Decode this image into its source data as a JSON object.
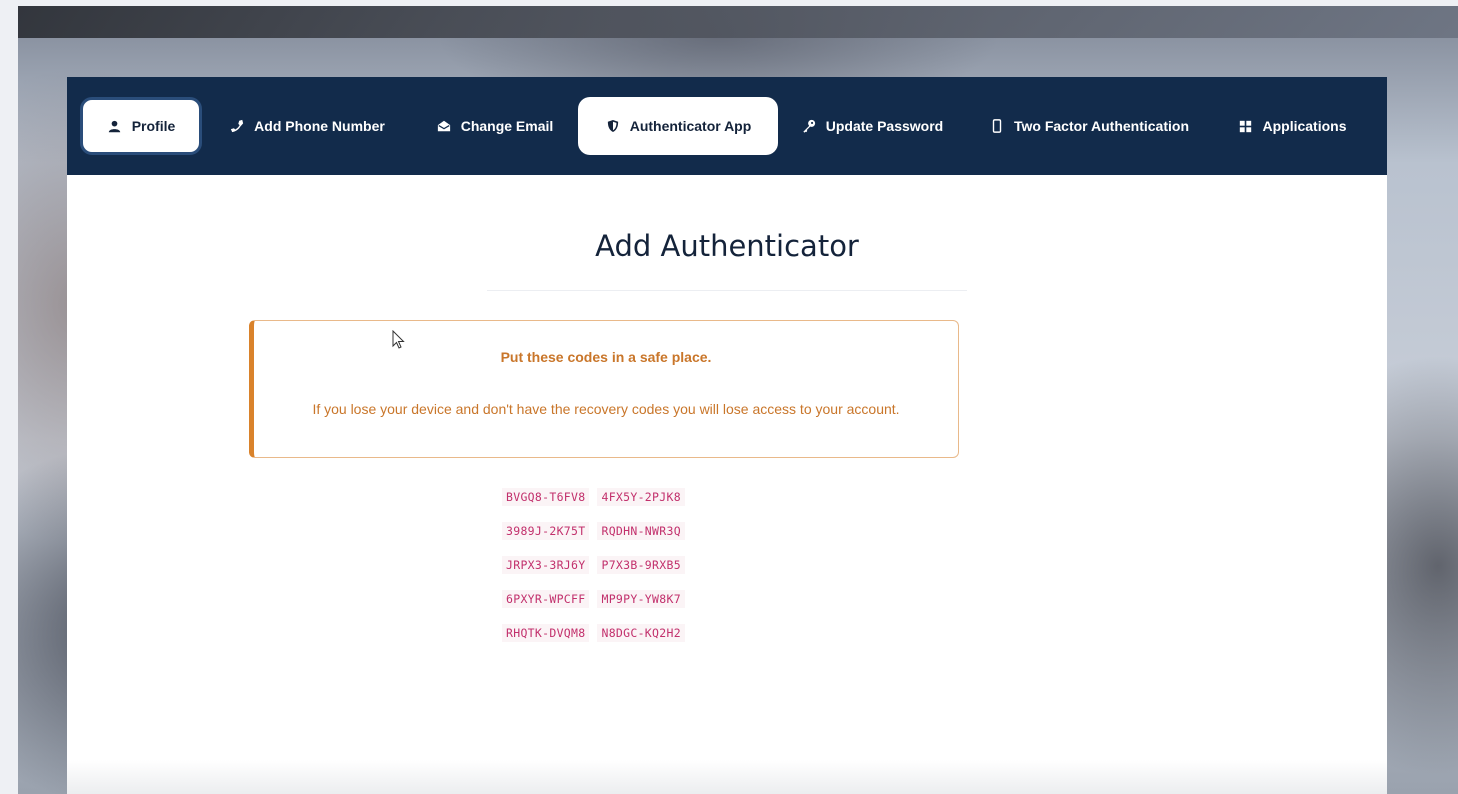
{
  "nav": {
    "tabs": [
      {
        "label": "Profile",
        "icon": "user-icon"
      },
      {
        "label": "Add Phone Number",
        "icon": "phone-icon"
      },
      {
        "label": "Change Email",
        "icon": "envelope-open-icon"
      },
      {
        "label": "Authenticator App",
        "icon": "shield-icon"
      },
      {
        "label": "Update Password",
        "icon": "key-icon"
      },
      {
        "label": "Two Factor Authentication",
        "icon": "mobile-icon"
      },
      {
        "label": "Applications",
        "icon": "grid-icon"
      }
    ],
    "active_tab": "Authenticator App"
  },
  "page": {
    "title": "Add Authenticator"
  },
  "alert": {
    "title": "Put these codes in a safe place.",
    "body": "If you lose your device and don't have the recovery codes you will lose access to your account."
  },
  "recovery_codes": [
    [
      "BVGQ8-T6FV8",
      "4FX5Y-2PJK8"
    ],
    [
      "3989J-2K75T",
      "RQDHN-NWR3Q"
    ],
    [
      "JRPX3-3RJ6Y",
      "P7X3B-9RXB5"
    ],
    [
      "6PXYR-WPCFF",
      "MP9PY-YW8K7"
    ],
    [
      "RHQTK-DVQM8",
      "N8DGC-KQ2H2"
    ]
  ],
  "colors": {
    "navbar": "#122b4b",
    "alert_accent": "#d9822b",
    "alert_text": "#c9762a",
    "code_text": "#c2306c"
  }
}
